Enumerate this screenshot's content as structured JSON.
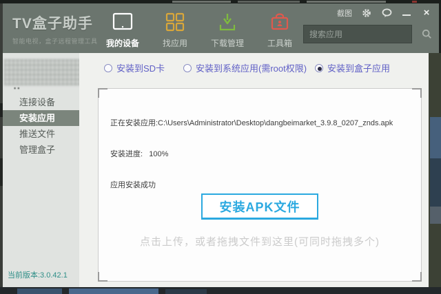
{
  "window": {
    "titlebar": {
      "screenshot_label": "截图",
      "icons": [
        "gear-icon",
        "feedback-bubble-icon",
        "minimize-icon",
        "close-icon"
      ]
    },
    "header": {
      "logo_title": "TV盒子助手",
      "logo_subtitle": "智能电视，盒子远程管理工具",
      "nav": [
        {
          "label": "我的设备",
          "icon": "tablet-device-icon",
          "active": true
        },
        {
          "label": "找应用",
          "icon": "app-grid-icon",
          "active": false
        },
        {
          "label": "下载管理",
          "icon": "download-tray-icon",
          "active": false
        },
        {
          "label": "工具箱",
          "icon": "toolbox-icon",
          "active": false
        }
      ],
      "search": {
        "placeholder": "搜索应用",
        "icon": "search-icon"
      }
    },
    "sidebar": {
      "items": [
        {
          "label": "连接设备",
          "active": false
        },
        {
          "label": "安装应用",
          "active": true
        },
        {
          "label": "推送文件",
          "active": false
        },
        {
          "label": "管理盒子",
          "active": false
        }
      ],
      "version_label": "当前版本:3.0.42.1"
    },
    "main": {
      "install_options": [
        {
          "label": "安装到SD卡",
          "selected": false
        },
        {
          "label": "安装到系统应用(需root权限)",
          "selected": false
        },
        {
          "label": "安装到盒子应用",
          "selected": true
        }
      ],
      "log_lines": [
        "正在安装应用:C:\\Users\\Administrator\\Desktop\\dangbeimarket_3.9.8_0207_znds.apk",
        "安装进度:   100%",
        "应用安装成功"
      ],
      "install_button_label": "安装APK文件",
      "dropzone_hint": "点击上传，或者拖拽文件到这里(可同时拖拽多个)"
    }
  },
  "colors": {
    "header_bg": "#6b756e",
    "sidebar_bg": "#e0e3e0",
    "sidebar_active_bg": "#7b857c",
    "main_bg": "#f0f1ee",
    "radio_text": "#6060c6",
    "button_accent": "#2ba9e0",
    "hint_text": "#cbcbcb",
    "version_text": "#2e8e87",
    "nav_find_icon": "#d9a73a",
    "nav_download_icon": "#7fba3f",
    "nav_toolbox_icon": "#e0594d"
  }
}
